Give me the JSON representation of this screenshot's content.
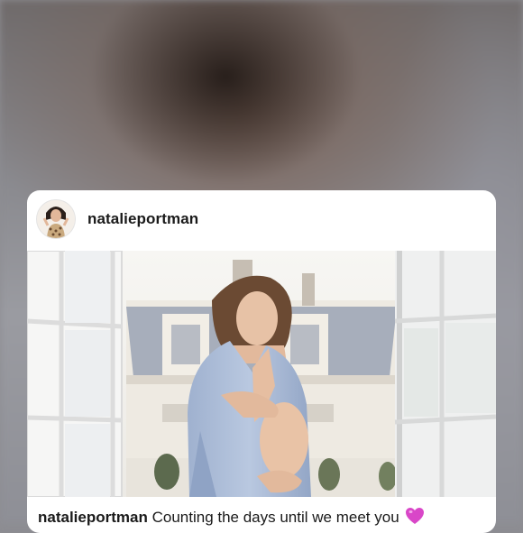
{
  "post": {
    "username": "natalieportman",
    "caption_user": "natalieportman",
    "caption_text": "Counting the days until we meet you",
    "caption_emoji": "purple-heart"
  },
  "colors": {
    "card_background": "#ffffff",
    "text": "#1a1a1a",
    "heart": "#d946c8"
  }
}
